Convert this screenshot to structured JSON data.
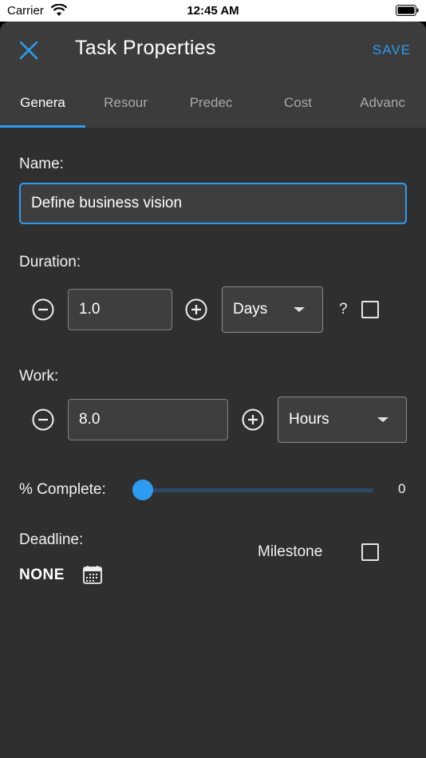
{
  "status_bar": {
    "carrier": "Carrier",
    "time": "12:45 AM"
  },
  "header": {
    "title": "Task Properties",
    "save_label": "SAVE"
  },
  "tabs": [
    {
      "label": "Genera",
      "active": true
    },
    {
      "label": "Resour",
      "active": false
    },
    {
      "label": "Predec",
      "active": false
    },
    {
      "label": "Cost",
      "active": false
    },
    {
      "label": "Advanc",
      "active": false
    }
  ],
  "general": {
    "name_label": "Name:",
    "name_value": "Define business vision",
    "duration_label": "Duration:",
    "duration_value": "1.0",
    "duration_unit": "Days",
    "estimated_mark": "?",
    "work_label": "Work:",
    "work_value": "8.0",
    "work_unit": "Hours",
    "complete_label": "% Complete:",
    "complete_value": "0",
    "deadline_label": "Deadline:",
    "deadline_value": "NONE",
    "milestone_label": "Milestone"
  },
  "icons": {
    "close": "close-icon",
    "minus": "minus-circle-icon",
    "plus": "plus-circle-icon",
    "calendar": "calendar-icon",
    "dropdown": "chevron-down-icon",
    "wifi": "wifi-icon",
    "battery": "battery-icon"
  },
  "colors": {
    "accent": "#2d9cf0",
    "header_bg": "#3c3c3c",
    "body_bg": "#2f2f2f",
    "field_bg": "#3e3e3e"
  }
}
